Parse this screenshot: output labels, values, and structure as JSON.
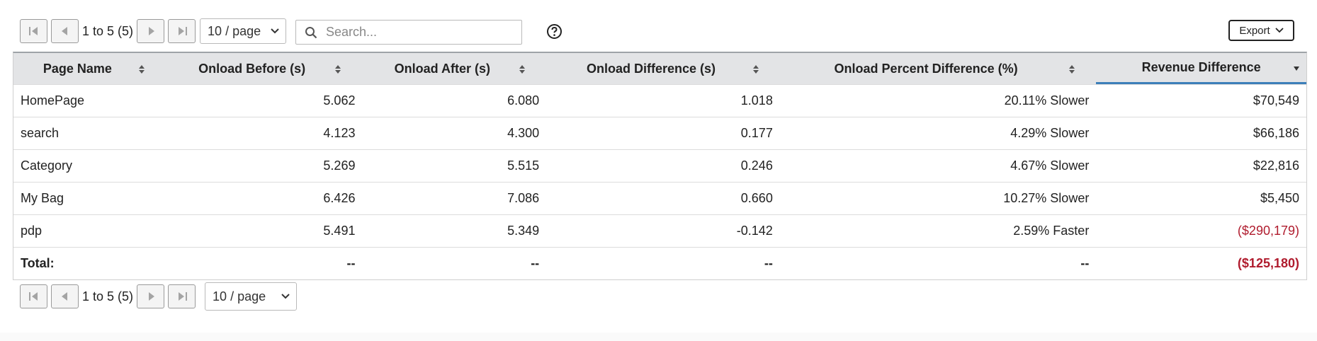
{
  "toolbar": {
    "pager_text": "1 to 5 (5)",
    "page_size": "10 / page",
    "search_placeholder": "Search...",
    "export_label": "Export"
  },
  "table": {
    "columns": [
      "Page Name",
      "Onload Before (s)",
      "Onload After (s)",
      "Onload Difference (s)",
      "Onload Percent Difference (%)",
      "Revenue Difference"
    ],
    "rows": [
      [
        "HomePage",
        "5.062",
        "6.080",
        "1.018",
        "20.11% Slower",
        "$70,549"
      ],
      [
        "search",
        "4.123",
        "4.300",
        "0.177",
        "4.29% Slower",
        "$66,186"
      ],
      [
        "Category",
        "5.269",
        "5.515",
        "0.246",
        "4.67% Slower",
        "$22,816"
      ],
      [
        "My Bag",
        "6.426",
        "7.086",
        "0.660",
        "10.27% Slower",
        "$5,450"
      ],
      [
        "pdp",
        "5.491",
        "5.349",
        "-0.142",
        "2.59% Faster",
        "($290,179)"
      ]
    ],
    "total": [
      "Total:",
      "--",
      "--",
      "--",
      "--",
      "($125,180)"
    ]
  },
  "bottom_pager": {
    "pager_text": "1 to 5 (5)",
    "page_size": "10 / page"
  },
  "colors": {
    "negative": "#b01c2e",
    "active_sort": "#3d7fb9",
    "header_bg": "#e3e4e6"
  },
  "icons": [
    "first-page-icon",
    "prev-page-icon",
    "next-page-icon",
    "last-page-icon",
    "search-icon",
    "help-icon",
    "chevron-down-icon",
    "sort-icon",
    "sort-desc-icon"
  ]
}
